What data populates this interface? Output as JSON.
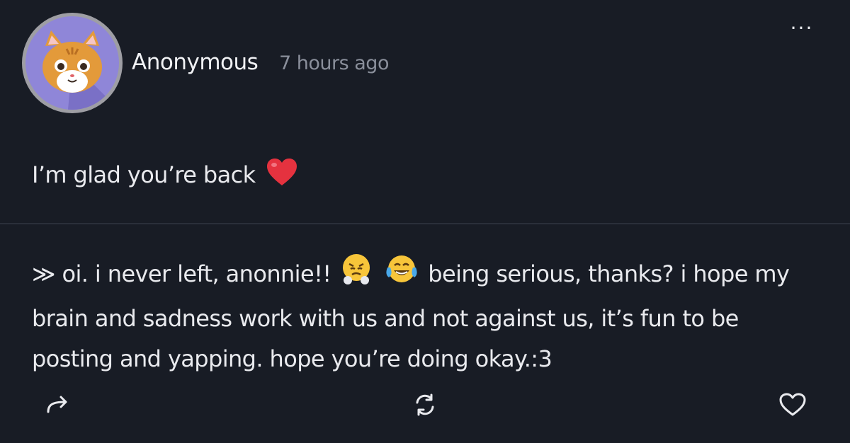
{
  "post": {
    "author": "Anonymous",
    "timestamp": "7 hours ago",
    "message": "I’m glad you’re back",
    "message_emoji": "red-heart"
  },
  "reply": {
    "marker": "≫",
    "part1": "oi. i never left, anonnie!!",
    "emoji1": "face-with-steam-from-nose",
    "emoji2": "face-with-tears-of-joy",
    "part2": " being serious, thanks? i hope my brain and sadness work with us and not against us, it’s fun to be posting and yapping. hope you’re doing okay.:3"
  },
  "menu": {
    "more_label": "···"
  },
  "icons": {
    "avatar": "cat-avatar",
    "share": "share-arrow-icon",
    "refresh": "refresh-icon",
    "like": "heart-outline-icon"
  },
  "colors": {
    "background": "#181c25",
    "text": "#e9eaee",
    "muted": "#8a8f9b",
    "avatar_bg": "#8f86d8"
  }
}
